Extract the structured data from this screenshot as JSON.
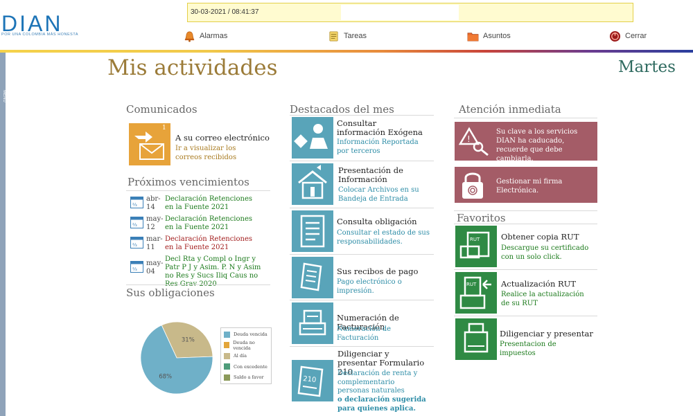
{
  "header": {
    "logo_text": "DIAN",
    "logo_tagline": "POR UNA COLOMBIA MÁS HONESTA",
    "datetime": "30-03-2021 / 08:41:37",
    "nav": [
      {
        "label": "Alarmas",
        "icon": "bell-icon"
      },
      {
        "label": "Tareas",
        "icon": "notepad-icon"
      },
      {
        "label": "Asuntos",
        "icon": "folder-icon"
      },
      {
        "label": "Cerrar",
        "icon": "power-icon"
      }
    ],
    "side_label": "MENU"
  },
  "page": {
    "title": "Mis actividades",
    "day": "Martes"
  },
  "comunicados": {
    "title": "Comunicados",
    "badge": "1",
    "item_title": "A su correo electrónico",
    "item_link": "Ir a visualizar los correos recibidos"
  },
  "vencimientos": {
    "title": "Próximos vencimientos",
    "items": [
      {
        "month": "abr-",
        "day": "14",
        "text": "Declaración Retenciones en la Fuente 2021",
        "color": "#1b7a1b"
      },
      {
        "month": "may-",
        "day": "12",
        "text": "Declaración Retenciones en la Fuente 2021",
        "color": "#1b7a1b"
      },
      {
        "month": "mar-",
        "day": "11",
        "text": "Declaración Retenciones en la Fuente 2021",
        "color": "#a11a1a"
      },
      {
        "month": "may-",
        "day": "04",
        "text": "Decl Rta y Compl o Ingr y Patr P J y Asim. P. N y Asim no Res y Sucs Iliq Caus no Res Grav 2020",
        "color": "#1b7a1b"
      }
    ]
  },
  "obligaciones": {
    "title": "Sus obligaciones",
    "chart_data": {
      "type": "pie",
      "labels": [
        "Deuda vencida",
        "Deuda no vencida",
        "Al día",
        "Con excedente",
        "Saldo a favor"
      ],
      "values": [
        68,
        0,
        31,
        0,
        0
      ],
      "slice_labels": [
        "68%",
        "31%"
      ],
      "colors": [
        "#6fb0c8",
        "#e3a53a",
        "#c8b98a",
        "#4e9c7a",
        "#8c9a5a"
      ]
    }
  },
  "destacados": {
    "title": "Destacados del mes",
    "items": [
      {
        "title": "Consultar información Exógena",
        "subtitle": "Información Reportada por terceros",
        "sub_bold": ""
      },
      {
        "title": "Presentación de Información",
        "subtitle": "Colocar Archivos en su Bandeja de Entrada",
        "sub_bold": ""
      },
      {
        "title": "Consulta obligación",
        "subtitle": "Consultar el estado de sus responsabilidades.",
        "sub_bold": ""
      },
      {
        "title": "Sus recibos de pago",
        "subtitle": "Pago electrónico o impresión.",
        "sub_bold": ""
      },
      {
        "title": "Numeración de Facturación",
        "subtitle": "Numeración de Facturación",
        "sub_bold": ""
      },
      {
        "title": "Diligenciar y presentar Formulario 210",
        "subtitle": "Declaración de renta y complementario personas naturales",
        "sub_bold": "o declaración sugerida para quienes aplica."
      }
    ],
    "form_number": "210"
  },
  "atencion": {
    "title": "Atención inmediata",
    "items": [
      {
        "text": "Su clave a los servicios DIAN ha caducado, recuerde que debe cambiarla."
      },
      {
        "text": "Gestionar mi firma Electrónica."
      }
    ]
  },
  "favoritos": {
    "title": "Favoritos",
    "rut_label": "RUT",
    "items": [
      {
        "title": "Obtener copia RUT",
        "subtitle": "Descargue su certificado con un solo click."
      },
      {
        "title": "Actualización RUT",
        "subtitle": "Realice la actualización de su RUT"
      },
      {
        "title": "Diligenciar y presentar",
        "subtitle": "Presentacion de impuestos"
      }
    ]
  }
}
